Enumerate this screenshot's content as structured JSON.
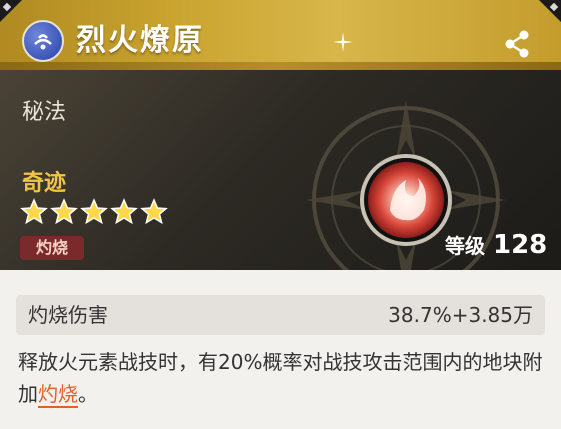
{
  "header": {
    "title": "烈火燎原",
    "element_icon": "fire-element-icon",
    "share_icon": "share-icon"
  },
  "info": {
    "type": "秘法",
    "rarity_label": "奇迹",
    "stars": 5,
    "tag": "灼烧",
    "level_label": "等级",
    "level_value": "128"
  },
  "stat": {
    "name": "灼烧伤害",
    "value": "38.7%+3.85万"
  },
  "description": {
    "part1": "释放火元素战技时，有20%概率对战技攻击范围内的地块附加",
    "keyword": "灼烧",
    "part2": "。"
  },
  "colors": {
    "title_bar": "#c9a32e",
    "panel": "#2d2a24",
    "rarity": "#f0c547",
    "keyword": "#e0622a",
    "tag_bg": "#7a2a2a"
  }
}
